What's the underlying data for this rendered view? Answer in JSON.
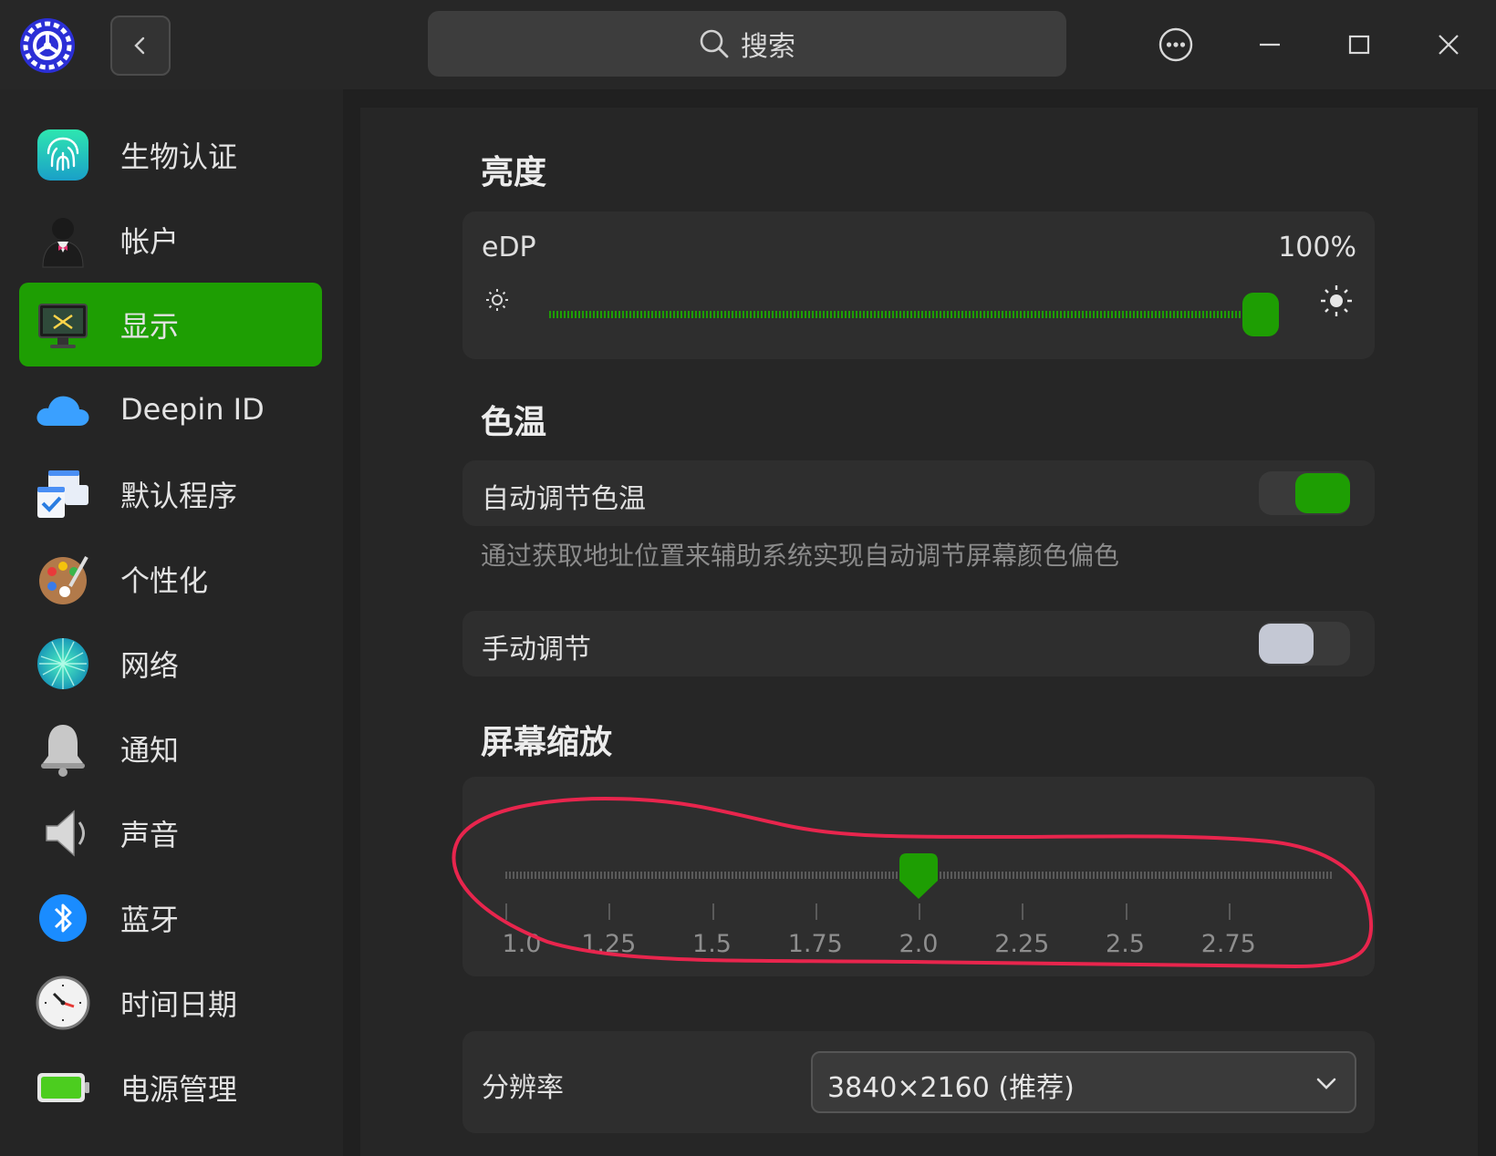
{
  "window": {
    "search_placeholder": "搜索",
    "icons": [
      "app-settings-icon",
      "back-icon",
      "search-icon",
      "more-icon",
      "minimize-icon",
      "maximize-icon",
      "close-icon"
    ]
  },
  "sidebar": {
    "items": [
      {
        "label": "生物认证",
        "icon": "fingerprint-icon"
      },
      {
        "label": "帐户",
        "icon": "account-icon"
      },
      {
        "label": "显示",
        "icon": "display-icon",
        "active": true
      },
      {
        "label": "Deepin ID",
        "icon": "cloud-icon"
      },
      {
        "label": "默认程序",
        "icon": "default-apps-icon"
      },
      {
        "label": "个性化",
        "icon": "palette-icon"
      },
      {
        "label": "网络",
        "icon": "network-icon"
      },
      {
        "label": "通知",
        "icon": "bell-icon"
      },
      {
        "label": "声音",
        "icon": "speaker-icon"
      },
      {
        "label": "蓝牙",
        "icon": "bluetooth-icon"
      },
      {
        "label": "时间日期",
        "icon": "clock-icon"
      },
      {
        "label": "电源管理",
        "icon": "battery-icon"
      }
    ]
  },
  "brightness": {
    "title": "亮度",
    "monitor": "eDP",
    "value_label": "100%",
    "value": 1.0
  },
  "color_temp": {
    "title": "色温",
    "auto_label": "自动调节色温",
    "auto_on": true,
    "hint": "通过获取地址位置来辅助系统实现自动调节屏幕颜色偏色",
    "manual_label": "手动调节",
    "manual_on": false
  },
  "scaling": {
    "title": "屏幕缩放",
    "ticks": [
      "1.0",
      "1.25",
      "1.5",
      "1.75",
      "2.0",
      "2.25",
      "2.5",
      "2.75"
    ],
    "value": "2.0"
  },
  "resolution": {
    "label": "分辨率",
    "value": "3840×2160 (推荐)"
  },
  "colors": {
    "accent": "#1e9e03",
    "annotation": "#e8254d"
  }
}
